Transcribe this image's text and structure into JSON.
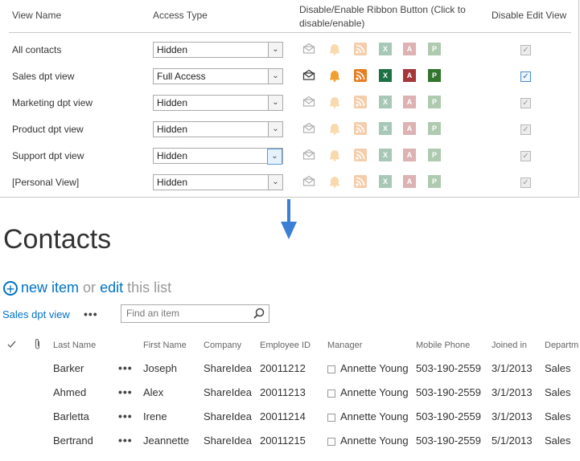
{
  "views_panel": {
    "headers": {
      "view_name": "View Name",
      "access_type": "Access Type",
      "ribbon": "Disable/Enable Ribbon Button (Click to disable/enable)",
      "disable_edit": "Disable Edit View"
    },
    "rows": [
      {
        "name": "All contacts",
        "access": "Hidden",
        "icons_enabled": false,
        "edit_disabled_active": false
      },
      {
        "name": "Sales dpt view",
        "access": "Full Access",
        "icons_enabled": true,
        "edit_disabled_active": true
      },
      {
        "name": "Marketing dpt view",
        "access": "Hidden",
        "icons_enabled": false,
        "edit_disabled_active": false
      },
      {
        "name": "Product dpt view",
        "access": "Hidden",
        "icons_enabled": false,
        "edit_disabled_active": false
      },
      {
        "name": "Support dpt view",
        "access": "Hidden",
        "icons_enabled": false,
        "edit_disabled_active": false
      },
      {
        "name": "[Personal View]",
        "access": "Hidden",
        "icons_enabled": false,
        "edit_disabled_active": false
      }
    ],
    "ribbon_icons": [
      "mail-icon",
      "alert-bell-icon",
      "rss-icon",
      "excel-icon",
      "access-icon",
      "project-icon"
    ],
    "check_mark": "✓",
    "select_arrow": "⌄"
  },
  "list": {
    "title": "Contacts",
    "new_item": "new item",
    "or": "or",
    "edit": "edit",
    "this_list": "this list",
    "current_view": "Sales dpt view",
    "view_more": "•••",
    "search_placeholder": "Find an item",
    "columns": [
      "Last Name",
      "First Name",
      "Company",
      "Employee ID",
      "Manager",
      "Mobile Phone",
      "Joined in",
      "Departm"
    ],
    "rows": [
      {
        "last": "Barker",
        "first": "Joseph",
        "company": "ShareIdea",
        "emp_id": "20011212",
        "manager": "Annette Young",
        "mobile": "503-190-2559",
        "joined": "3/1/2013",
        "dept": "Sales"
      },
      {
        "last": "Ahmed",
        "first": "Alex",
        "company": "ShareIdea",
        "emp_id": "20011213",
        "manager": "Annette Young",
        "mobile": "503-190-2559",
        "joined": "3/1/2013",
        "dept": "Sales"
      },
      {
        "last": "Barletta",
        "first": "Irene",
        "company": "ShareIdea",
        "emp_id": "20011214",
        "manager": "Annette Young",
        "mobile": "503-190-2559",
        "joined": "3/1/2013",
        "dept": "Sales"
      },
      {
        "last": "Bertrand",
        "first": "Jeannette",
        "company": "ShareIdea",
        "emp_id": "20011215",
        "manager": "Annette Young",
        "mobile": "503-190-2559",
        "joined": "5/1/2013",
        "dept": "Sales"
      }
    ],
    "row_more": "•••"
  },
  "colors": {
    "accent": "#0072c6",
    "arrow": "#3a7fd5"
  }
}
